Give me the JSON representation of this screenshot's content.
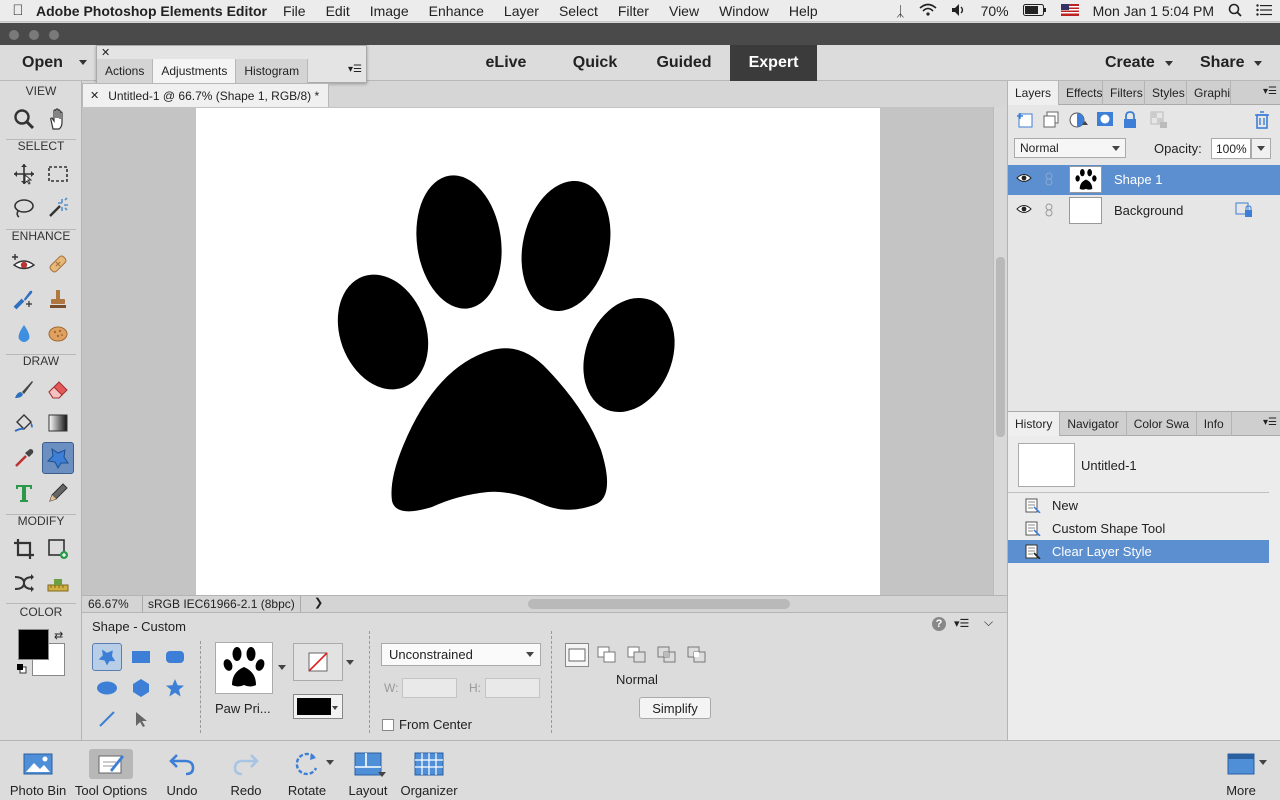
{
  "menubar": {
    "app_name": "Adobe Photoshop Elements Editor",
    "items": [
      "File",
      "Edit",
      "Image",
      "Enhance",
      "Layer",
      "Select",
      "Filter",
      "View",
      "Window",
      "Help"
    ],
    "battery": "70%",
    "datetime": "Mon Jan 1  5:04 PM"
  },
  "modebar": {
    "open_label": "Open",
    "tabs": [
      "eLive",
      "Quick",
      "Guided",
      "Expert"
    ],
    "active_tab": "Expert",
    "create_label": "Create",
    "share_label": "Share"
  },
  "float_panel": {
    "tabs": [
      "Actions",
      "Adjustments",
      "Histogram"
    ],
    "active_tab": "Adjustments"
  },
  "toolbox": {
    "sections": [
      "VIEW",
      "SELECT",
      "ENHANCE",
      "DRAW",
      "MODIFY",
      "COLOR"
    ],
    "active_tool": "custom-shape-tool"
  },
  "document": {
    "tab_title": "Untitled-1 @ 66.7% (Shape 1, RGB/8) *",
    "zoom": "66.67%",
    "profile": "sRGB IEC61966-2.1 (8bpc)"
  },
  "tool_options": {
    "title": "Shape - Custom",
    "preset_label": "Paw Pri...",
    "constraint": "Unconstrained",
    "w_label": "W:",
    "h_label": "H:",
    "from_center_label": "From Center",
    "from_center_checked": false,
    "combine_mode": "Normal",
    "simplify_label": "Simplify",
    "help_label": "?",
    "color": "#000000"
  },
  "taskbar": {
    "items": [
      "Photo Bin",
      "Tool Options",
      "Undo",
      "Redo",
      "Rotate",
      "Layout",
      "Organizer"
    ],
    "active_item": "Tool Options",
    "more_label": "More"
  },
  "layers_panel": {
    "tabs": [
      "Layers",
      "Effects",
      "Filters",
      "Styles",
      "Graphi"
    ],
    "active_tab": "Layers",
    "blend_mode": "Normal",
    "opacity_label": "Opacity:",
    "opacity_value": "100%",
    "layers": [
      {
        "name": "Shape 1",
        "selected": true
      },
      {
        "name": "Background",
        "selected": false
      }
    ]
  },
  "history_panel": {
    "tabs": [
      "History",
      "Navigator",
      "Color Swa",
      "Info"
    ],
    "active_tab": "History",
    "snapshot_label": "Untitled-1",
    "items": [
      "New",
      "Custom Shape Tool",
      "Clear Layer Style"
    ],
    "selected_item": "Clear Layer Style"
  },
  "colors": {
    "accent": "#5c8fcf",
    "foreground": "#000000",
    "background": "#ffffff"
  }
}
